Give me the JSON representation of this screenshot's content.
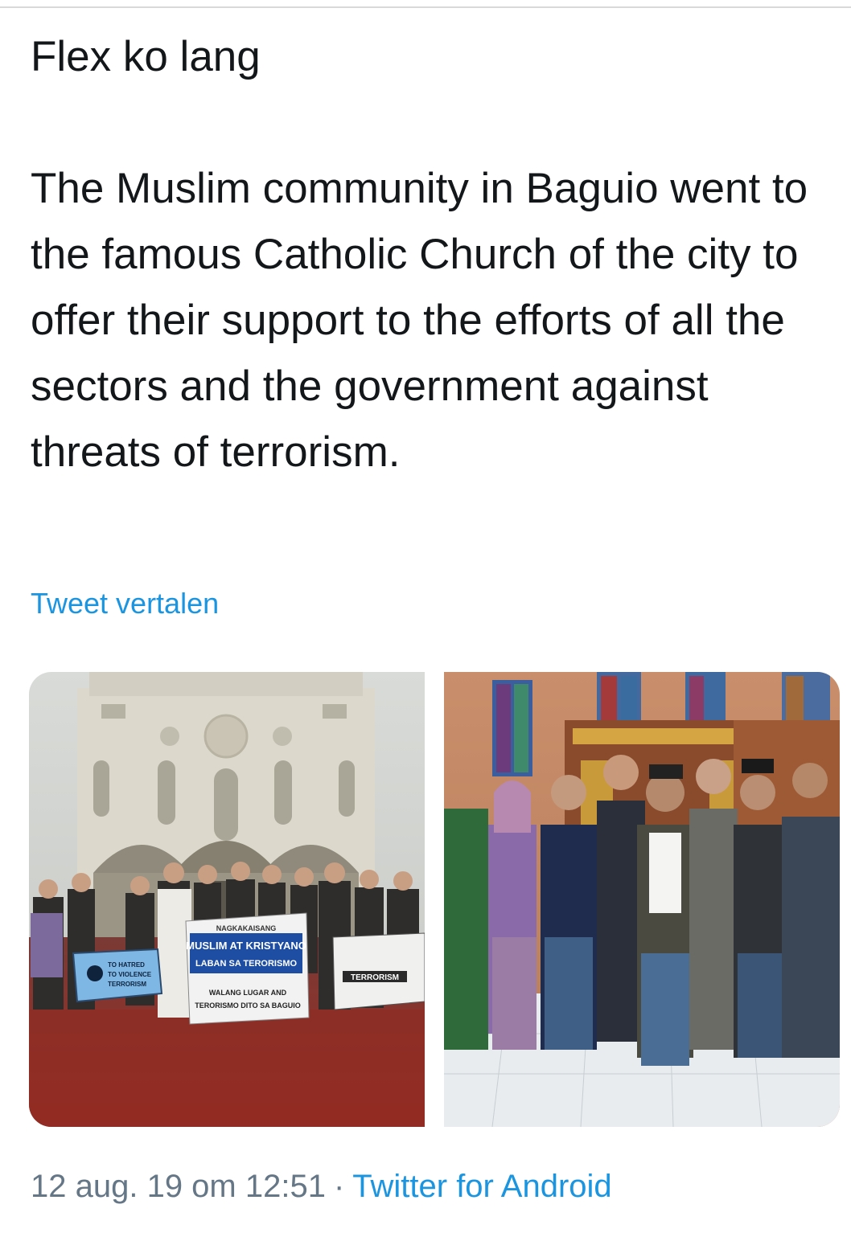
{
  "tweet": {
    "title_line": "Flex ko lang",
    "body": "The Muslim community in Baguio went to the famous Catholic Church of the city to offer their support to the efforts of all the sectors and the government against threats of terrorism.",
    "translate_label": "Tweet vertalen",
    "timestamp": "12 aug. 19 om 12:51",
    "separator": "·",
    "source": "Twitter for Android"
  },
  "media": {
    "left_photo": {
      "banner_main": [
        "NAGKAKAISANG",
        "MUSLIM AT KRISTYANO",
        "LABAN SA TERORISMO",
        "WALANG LUGAR AND",
        "TERORISMO DITO SA BAGUIO"
      ],
      "banner_left": [
        "TO HATRED",
        "TO VIOLENCE",
        "TERRORISM"
      ],
      "banner_right": [
        "TERRORISM"
      ]
    }
  },
  "colors": {
    "text": "#14171a",
    "link": "#1b95e0",
    "meta": "#657786"
  }
}
